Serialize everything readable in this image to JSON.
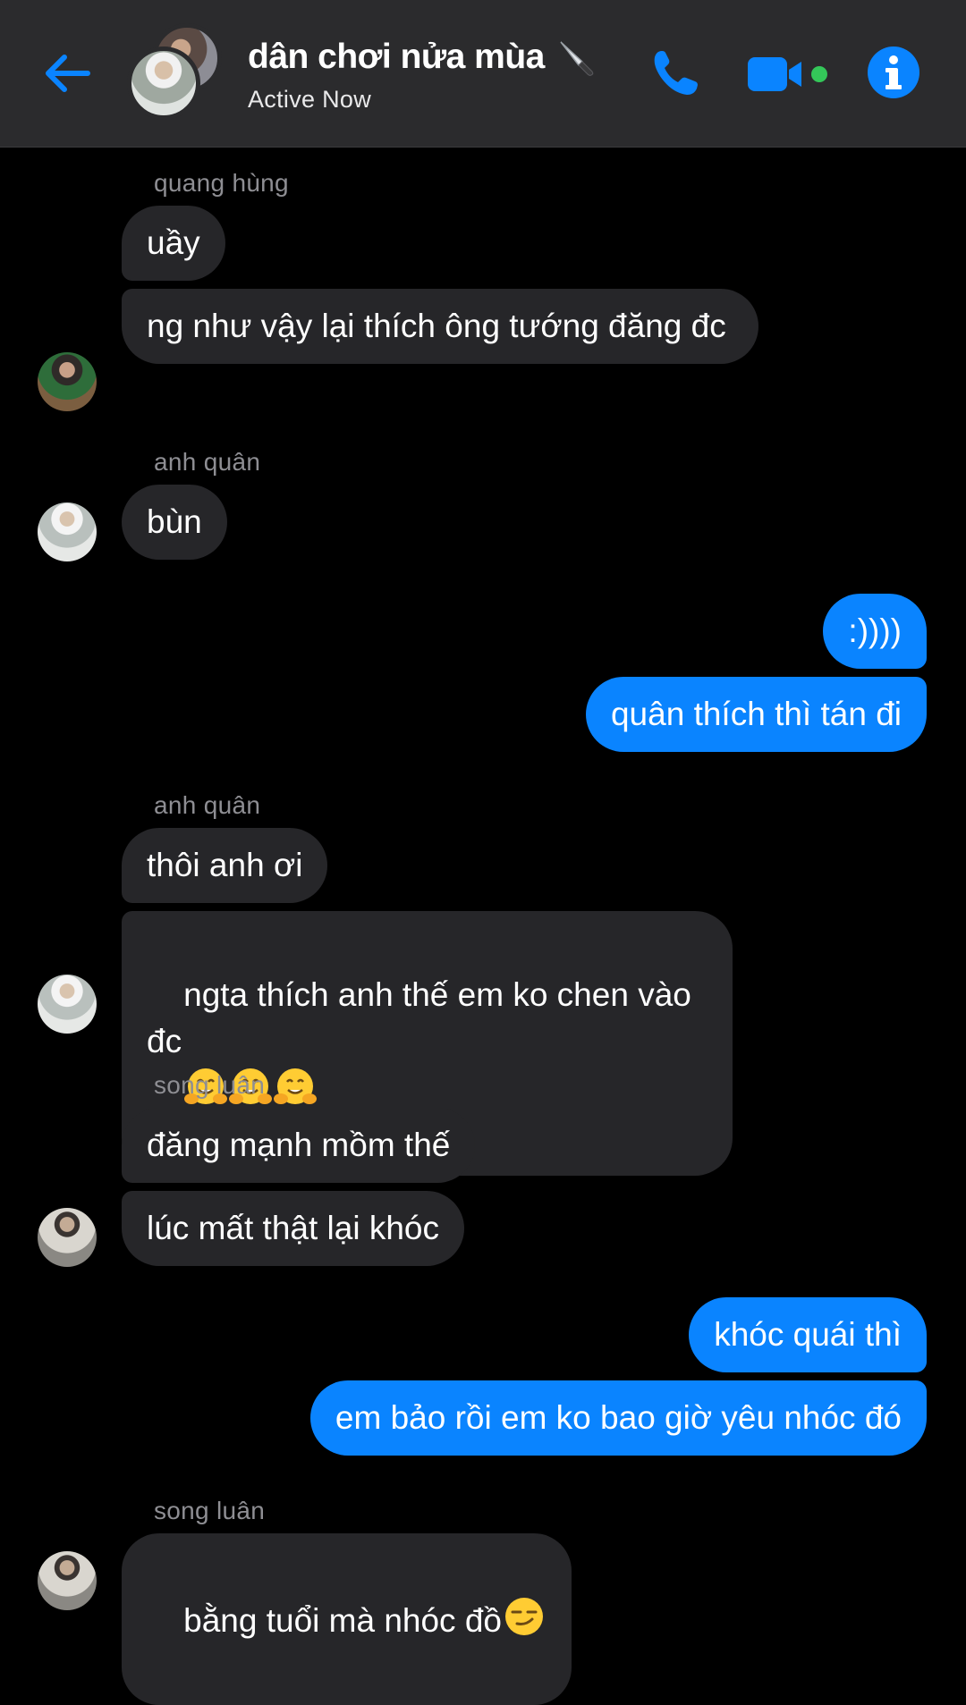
{
  "header": {
    "title": "dân chơi nửa mùa",
    "status": "Active Now",
    "icons": {
      "back": "back-arrow-icon",
      "title_emoji": "knife-emoji",
      "call": "phone-icon",
      "video": "video-camera-icon",
      "info": "info-icon"
    },
    "accent_color": "#0a84ff",
    "active_dot_color": "#34c759"
  },
  "messages": [
    {
      "sender": "quang hùng",
      "direction": "in",
      "texts": [
        "uầy",
        "ng như vậy lại thích ông tướng đăng đc"
      ]
    },
    {
      "sender": "anh quân",
      "direction": "in",
      "texts": [
        "bùn"
      ]
    },
    {
      "sender": "",
      "direction": "out",
      "texts": [
        ":))))",
        "quân thích thì tán đi"
      ]
    },
    {
      "sender": "anh quân",
      "direction": "in",
      "texts": [
        "thôi anh ơi",
        "ngta thích anh thế em ko chen vào đc"
      ],
      "emoji": "hugging-face-emoji x3"
    },
    {
      "sender": "song luân",
      "direction": "in",
      "texts": [
        "đăng mạnh mồm thế",
        "lúc mất thật lại khóc"
      ]
    },
    {
      "sender": "",
      "direction": "out",
      "texts": [
        "khóc quái thì",
        "em bảo rồi em ko bao giờ yêu nhóc đó"
      ]
    },
    {
      "sender": "song luân",
      "direction": "in",
      "texts": [
        "bằng tuổi mà nhóc đồ"
      ],
      "emoji": "smirking-face-emoji"
    }
  ],
  "colors": {
    "incoming_bubble": "#262629",
    "outgoing_bubble": "#0a84ff",
    "sender_name": "#8e8e93",
    "header_bg": "#2b2b2d"
  }
}
